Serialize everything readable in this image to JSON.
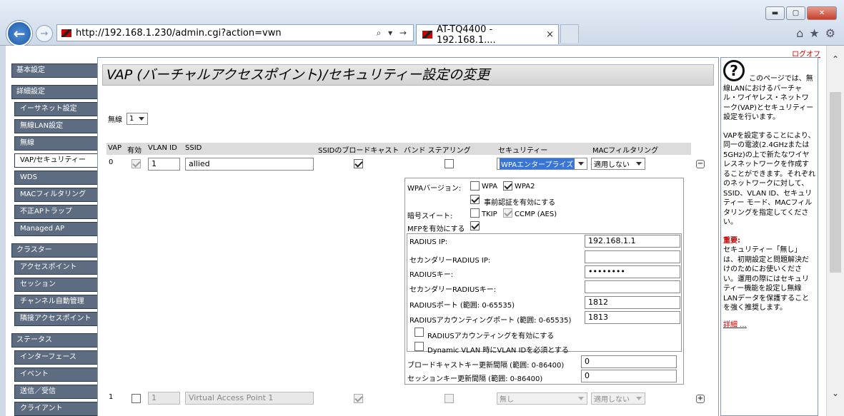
{
  "browser": {
    "url": "http://192.168.1.230/admin.cgi?action=vwn",
    "tab_title": "AT-TQ4400 - 192.168.1....",
    "tab_close": "×",
    "addr_tools": "⌕ ▾ →",
    "win": {
      "min": "▬",
      "max": "▢",
      "close": "✕"
    },
    "icons": {
      "home": "⌂",
      "star": "★",
      "gear": "⚙"
    }
  },
  "logout": "ログオフ",
  "sidebar": {
    "groups": [
      {
        "header": "基本設定",
        "items": []
      },
      {
        "header": "詳細設定",
        "items": [
          "イーサネット設定",
          "無線LAN設定",
          "無線",
          "VAP/セキュリティー",
          "WDS",
          "MACフィルタリング",
          "不正APトラップ",
          "Managed AP"
        ]
      },
      {
        "header": "クラスター",
        "items": [
          "アクセスポイント",
          "セッション",
          "チャンネル自動管理",
          "隣接アクセスポイント"
        ]
      },
      {
        "header": "ステータス",
        "items": [
          "インターフェース",
          "イベント",
          "送信／受信",
          "クライアント"
        ]
      }
    ]
  },
  "page_title": "VAP (バーチャルアクセスポイント)/セキュリティー設定の変更",
  "radio_label": "無線",
  "radio_value": "1",
  "table": {
    "headers": {
      "vap": "VAP",
      "enabled": "有効",
      "vlan": "VLAN ID",
      "ssid": "SSID",
      "broadcast": "SSIDのブロードキャスト",
      "band": "バンド ステアリング",
      "security": "セキュリティー",
      "mac": "MACフィルタリング"
    },
    "rows": [
      {
        "vap": "0",
        "vlan": "1",
        "ssid": "allied",
        "security": "WPAエンタープライズ",
        "mac": "適用しない",
        "toggle": "−"
      },
      {
        "vap": "1",
        "vlan": "1",
        "ssid": "Virtual Access Point 1",
        "security": "無し",
        "mac": "適用しない",
        "toggle": "+"
      }
    ]
  },
  "wpa": {
    "version_label": "WPAバージョン:",
    "wpa": "WPA",
    "wpa2": "WPA2",
    "preauth": "事前認証を有効にする",
    "cipher_label": "暗号スイート:",
    "tkip": "TKIP",
    "ccmp": "CCMP (AES)",
    "mfp": "MFPを有効にする"
  },
  "radius": {
    "ip_label": "RADIUS IP:",
    "ip": "192.168.1.1",
    "ip2_label": "セカンダリーRADIUS IP:",
    "ip2": "",
    "key_label": "RADIUSキー:",
    "key": "••••••••",
    "key2_label": "セカンダリーRADIUSキー:",
    "key2": "",
    "port_label": "RADIUSポート (範囲: 0-65535)",
    "port": "1812",
    "acct_port_label": "RADIUSアカウンティングポート (範囲: 0-65535)",
    "acct_port": "1813",
    "acct_enable": "RADIUSアカウンティングを有効にする",
    "dyn_vlan": "Dynamic VLAN 時にVLAN IDを必須とする",
    "bcast_key_label": "ブロードキャストキー更新間隔 (範囲: 0-86400)",
    "bcast_key": "0",
    "session_key_label": "セッションキー更新間隔 (範囲: 0-86400)",
    "session_key": "0"
  },
  "help": {
    "icon": "?",
    "text1": "このページでは、無線LANにおけるバーチャル・ワイヤレス・ネットワーク(VAP)とセキュリティー設定を行います。",
    "text2": "VAPを設定することにより、同一の電波(2.4GHzまたは5GHz)の上で新たなワイヤレスネットワークを作成することができます。それぞれのネットワークに対して、SSID、VLAN ID、セキュリティー モード、MACフィルタリングを指定してください。",
    "warn": "重要:",
    "text3": "セキュリティー「無し」は、初期設定と問題解決だけのためにお使いください。運用の際にはセキュリティー機能を設定し無線LANデータを保護することを強く推奨します。",
    "more": "詳細 ..."
  }
}
